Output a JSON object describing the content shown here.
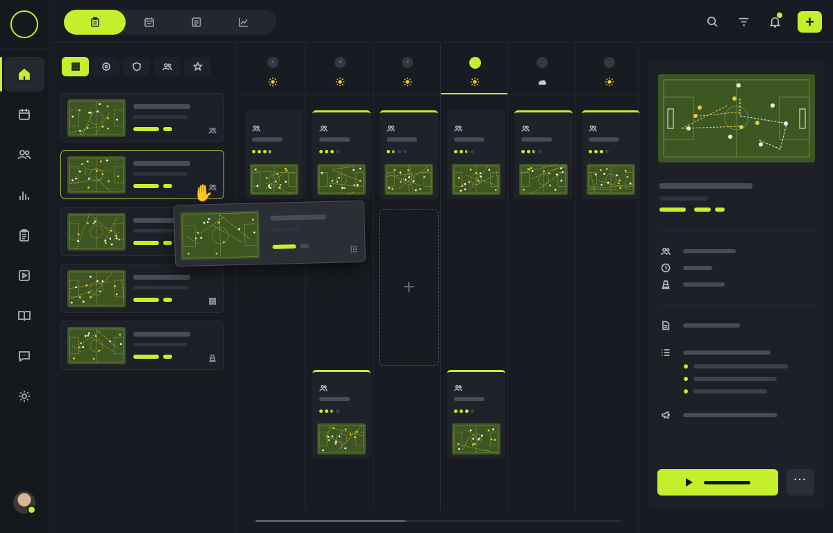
{
  "rail": {
    "items": [
      {
        "name": "home-icon",
        "active": true
      },
      {
        "name": "calendar-icon",
        "active": false
      },
      {
        "name": "team-icon",
        "active": false
      },
      {
        "name": "stats-icon",
        "active": false
      },
      {
        "name": "clipboard-icon",
        "active": false
      },
      {
        "name": "video-icon",
        "active": false
      },
      {
        "name": "book-icon",
        "active": false
      },
      {
        "name": "chat-icon",
        "active": false
      },
      {
        "name": "settings-icon",
        "active": false
      }
    ]
  },
  "topbar": {
    "view_tabs": [
      "clipboard-icon",
      "calendar-icon",
      "document-icon",
      "chart-icon"
    ],
    "active_view": 0,
    "actions": [
      "search-icon",
      "filter-icon",
      "bell-icon"
    ],
    "add_label": "+"
  },
  "library": {
    "filters": [
      "grid-icon",
      "target-icon",
      "shield-icon",
      "team-icon",
      "star-icon"
    ],
    "active_filter": 0,
    "drills": [
      {
        "type_icon": "team-icon",
        "selected": false
      },
      {
        "type_icon": "team-icon",
        "selected": true
      },
      {
        "type_icon": "grid-icon",
        "selected": false
      },
      {
        "type_icon": "grid-icon",
        "selected": false
      },
      {
        "type_icon": "cone-icon",
        "selected": false
      }
    ]
  },
  "board": {
    "days": [
      {
        "label": "s",
        "weather": "sun-icon",
        "today": false
      },
      {
        "label": "d",
        "weather": "sun-icon",
        "today": false
      },
      {
        "label": "#",
        "weather": "sun-icon",
        "today": false
      },
      {
        "label": "",
        "weather": "sun-icon",
        "today": true
      },
      {
        "label": "",
        "weather": "cloud-icon",
        "today": false
      },
      {
        "label": "",
        "weather": "sun-icon",
        "today": false
      }
    ],
    "dropzone_label": "+"
  },
  "detail": {
    "meta_icons": [
      "team-icon",
      "clock-icon",
      "cone-icon"
    ],
    "section_icons": [
      "document-icon",
      "list-icon",
      "megaphone-icon"
    ],
    "more_label": "···"
  },
  "colors": {
    "accent": "#c4ef2c",
    "bg": "#181b21",
    "card": "#1d2026",
    "pitch": "#3f5a22"
  }
}
